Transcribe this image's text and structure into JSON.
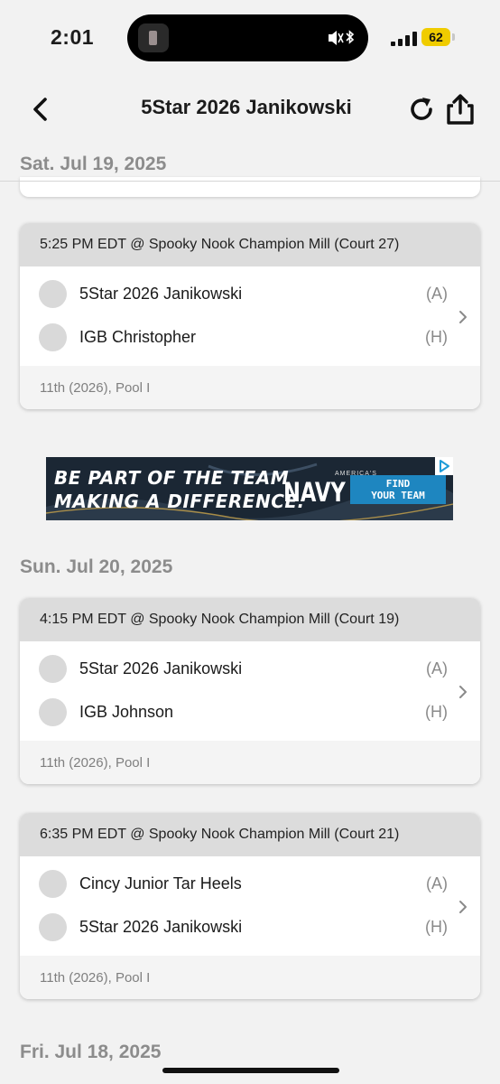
{
  "status_bar": {
    "time": "2:01",
    "battery": "62"
  },
  "nav": {
    "title": "5Star 2026 Janikowski"
  },
  "days": [
    {
      "date": "Sat. Jul 19, 2025"
    },
    {
      "date": "Sun. Jul 20, 2025"
    },
    {
      "date": "Fri. Jul 18, 2025"
    }
  ],
  "matches": [
    {
      "header": "5:25 PM EDT @ Spooky Nook Champion Mill (Court 27)",
      "teams": [
        {
          "name": "5Star 2026 Janikowski",
          "side": "(A)"
        },
        {
          "name": "IGB Christopher",
          "side": "(H)"
        }
      ],
      "footer": "11th (2026), Pool I"
    },
    {
      "header": "4:15 PM EDT @ Spooky Nook Champion Mill (Court 19)",
      "teams": [
        {
          "name": "5Star 2026 Janikowski",
          "side": "(A)"
        },
        {
          "name": "IGB Johnson",
          "side": "(H)"
        }
      ],
      "footer": "11th (2026), Pool I"
    },
    {
      "header": "6:35 PM EDT @ Spooky Nook Champion Mill (Court 21)",
      "teams": [
        {
          "name": "Cincy Junior Tar Heels",
          "side": "(A)"
        },
        {
          "name": "5Star 2026 Janikowski",
          "side": "(H)"
        }
      ],
      "footer": "11th (2026), Pool I"
    }
  ],
  "ad": {
    "line1": "BE PART OF THE TEAM",
    "line2": "MAKING A DIFFERENCE.",
    "brand_small": "AMERICA'S",
    "brand": "NAVY",
    "cta_line1": "FIND",
    "cta_line2": "YOUR TEAM"
  },
  "colors": {
    "background": "#f2f2f2",
    "card_header": "#dcdcdc",
    "battery": "#f0cc00",
    "ad_button": "#1e86c0"
  }
}
